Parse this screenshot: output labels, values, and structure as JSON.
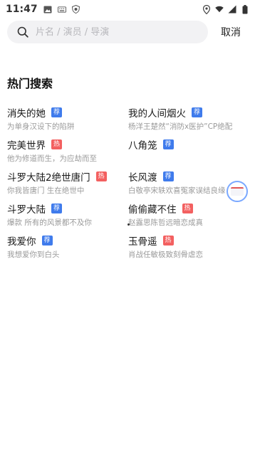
{
  "status_bar": {
    "time": "11:47",
    "left_icons": [
      "image-icon",
      "keyboard-icon",
      "shield-icon"
    ],
    "right_icons": [
      "location-icon",
      "wifi-icon",
      "signal-icon",
      "battery-icon"
    ]
  },
  "search": {
    "placeholder": "片名 / 演员 / 导演",
    "cancel_label": "取消"
  },
  "hot_search": {
    "title": "热门搜索",
    "colors": {
      "recommend": "#3f7bec",
      "hot": "#f36060"
    },
    "items": [
      {
        "title": "消失的她",
        "badge": "荐",
        "badge_type": "recommend",
        "subtitle": "为单身汉设下的陷阱"
      },
      {
        "title": "我的人间烟火",
        "badge": "荐",
        "badge_type": "recommend",
        "subtitle": "杨洋王楚然“消防x医护”CP绝配"
      },
      {
        "title": "完美世界",
        "badge": "热",
        "badge_type": "hot",
        "subtitle": "他为修道而生，为应劫而至"
      },
      {
        "title": "八角笼",
        "badge": "荐",
        "badge_type": "recommend",
        "subtitle": ""
      },
      {
        "title": "斗罗大陆2绝世唐门",
        "badge": "热",
        "badge_type": "hot",
        "subtitle": "你我皆唐门 生在绝世中"
      },
      {
        "title": "长风渡",
        "badge": "荐",
        "badge_type": "recommend",
        "subtitle": "白敬亭宋轶欢喜冤家误结良缘"
      },
      {
        "title": "斗罗大陆",
        "badge": "荐",
        "badge_type": "recommend",
        "subtitle": "爆款 所有的风景都不及你"
      },
      {
        "title": "偷偷藏不住",
        "badge": "热",
        "badge_type": "hot",
        "subtitle": "赵露思陈哲远暗恋成真"
      },
      {
        "title": "我爱你",
        "badge": "荐",
        "badge_type": "recommend",
        "subtitle": "我想爱你到白头"
      },
      {
        "title": "玉骨遥",
        "badge": "热",
        "badge_type": "hot",
        "subtitle": "肖战任敏极致刻骨虐恋"
      }
    ]
  }
}
